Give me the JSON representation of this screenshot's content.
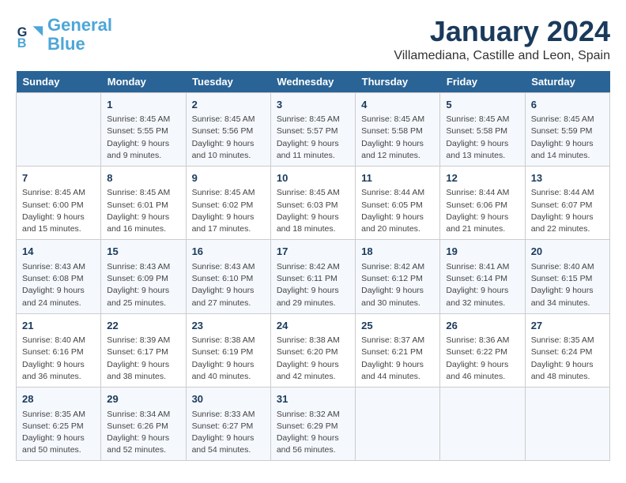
{
  "logo": {
    "text_general": "General",
    "text_blue": "Blue"
  },
  "title": "January 2024",
  "subtitle": "Villamediana, Castille and Leon, Spain",
  "days_of_week": [
    "Sunday",
    "Monday",
    "Tuesday",
    "Wednesday",
    "Thursday",
    "Friday",
    "Saturday"
  ],
  "weeks": [
    [
      {
        "day": "",
        "sunrise": "",
        "sunset": "",
        "daylight": ""
      },
      {
        "day": "1",
        "sunrise": "Sunrise: 8:45 AM",
        "sunset": "Sunset: 5:55 PM",
        "daylight": "Daylight: 9 hours and 9 minutes."
      },
      {
        "day": "2",
        "sunrise": "Sunrise: 8:45 AM",
        "sunset": "Sunset: 5:56 PM",
        "daylight": "Daylight: 9 hours and 10 minutes."
      },
      {
        "day": "3",
        "sunrise": "Sunrise: 8:45 AM",
        "sunset": "Sunset: 5:57 PM",
        "daylight": "Daylight: 9 hours and 11 minutes."
      },
      {
        "day": "4",
        "sunrise": "Sunrise: 8:45 AM",
        "sunset": "Sunset: 5:58 PM",
        "daylight": "Daylight: 9 hours and 12 minutes."
      },
      {
        "day": "5",
        "sunrise": "Sunrise: 8:45 AM",
        "sunset": "Sunset: 5:58 PM",
        "daylight": "Daylight: 9 hours and 13 minutes."
      },
      {
        "day": "6",
        "sunrise": "Sunrise: 8:45 AM",
        "sunset": "Sunset: 5:59 PM",
        "daylight": "Daylight: 9 hours and 14 minutes."
      }
    ],
    [
      {
        "day": "7",
        "sunrise": "Sunrise: 8:45 AM",
        "sunset": "Sunset: 6:00 PM",
        "daylight": "Daylight: 9 hours and 15 minutes."
      },
      {
        "day": "8",
        "sunrise": "Sunrise: 8:45 AM",
        "sunset": "Sunset: 6:01 PM",
        "daylight": "Daylight: 9 hours and 16 minutes."
      },
      {
        "day": "9",
        "sunrise": "Sunrise: 8:45 AM",
        "sunset": "Sunset: 6:02 PM",
        "daylight": "Daylight: 9 hours and 17 minutes."
      },
      {
        "day": "10",
        "sunrise": "Sunrise: 8:45 AM",
        "sunset": "Sunset: 6:03 PM",
        "daylight": "Daylight: 9 hours and 18 minutes."
      },
      {
        "day": "11",
        "sunrise": "Sunrise: 8:44 AM",
        "sunset": "Sunset: 6:05 PM",
        "daylight": "Daylight: 9 hours and 20 minutes."
      },
      {
        "day": "12",
        "sunrise": "Sunrise: 8:44 AM",
        "sunset": "Sunset: 6:06 PM",
        "daylight": "Daylight: 9 hours and 21 minutes."
      },
      {
        "day": "13",
        "sunrise": "Sunrise: 8:44 AM",
        "sunset": "Sunset: 6:07 PM",
        "daylight": "Daylight: 9 hours and 22 minutes."
      }
    ],
    [
      {
        "day": "14",
        "sunrise": "Sunrise: 8:43 AM",
        "sunset": "Sunset: 6:08 PM",
        "daylight": "Daylight: 9 hours and 24 minutes."
      },
      {
        "day": "15",
        "sunrise": "Sunrise: 8:43 AM",
        "sunset": "Sunset: 6:09 PM",
        "daylight": "Daylight: 9 hours and 25 minutes."
      },
      {
        "day": "16",
        "sunrise": "Sunrise: 8:43 AM",
        "sunset": "Sunset: 6:10 PM",
        "daylight": "Daylight: 9 hours and 27 minutes."
      },
      {
        "day": "17",
        "sunrise": "Sunrise: 8:42 AM",
        "sunset": "Sunset: 6:11 PM",
        "daylight": "Daylight: 9 hours and 29 minutes."
      },
      {
        "day": "18",
        "sunrise": "Sunrise: 8:42 AM",
        "sunset": "Sunset: 6:12 PM",
        "daylight": "Daylight: 9 hours and 30 minutes."
      },
      {
        "day": "19",
        "sunrise": "Sunrise: 8:41 AM",
        "sunset": "Sunset: 6:14 PM",
        "daylight": "Daylight: 9 hours and 32 minutes."
      },
      {
        "day": "20",
        "sunrise": "Sunrise: 8:40 AM",
        "sunset": "Sunset: 6:15 PM",
        "daylight": "Daylight: 9 hours and 34 minutes."
      }
    ],
    [
      {
        "day": "21",
        "sunrise": "Sunrise: 8:40 AM",
        "sunset": "Sunset: 6:16 PM",
        "daylight": "Daylight: 9 hours and 36 minutes."
      },
      {
        "day": "22",
        "sunrise": "Sunrise: 8:39 AM",
        "sunset": "Sunset: 6:17 PM",
        "daylight": "Daylight: 9 hours and 38 minutes."
      },
      {
        "day": "23",
        "sunrise": "Sunrise: 8:38 AM",
        "sunset": "Sunset: 6:19 PM",
        "daylight": "Daylight: 9 hours and 40 minutes."
      },
      {
        "day": "24",
        "sunrise": "Sunrise: 8:38 AM",
        "sunset": "Sunset: 6:20 PM",
        "daylight": "Daylight: 9 hours and 42 minutes."
      },
      {
        "day": "25",
        "sunrise": "Sunrise: 8:37 AM",
        "sunset": "Sunset: 6:21 PM",
        "daylight": "Daylight: 9 hours and 44 minutes."
      },
      {
        "day": "26",
        "sunrise": "Sunrise: 8:36 AM",
        "sunset": "Sunset: 6:22 PM",
        "daylight": "Daylight: 9 hours and 46 minutes."
      },
      {
        "day": "27",
        "sunrise": "Sunrise: 8:35 AM",
        "sunset": "Sunset: 6:24 PM",
        "daylight": "Daylight: 9 hours and 48 minutes."
      }
    ],
    [
      {
        "day": "28",
        "sunrise": "Sunrise: 8:35 AM",
        "sunset": "Sunset: 6:25 PM",
        "daylight": "Daylight: 9 hours and 50 minutes."
      },
      {
        "day": "29",
        "sunrise": "Sunrise: 8:34 AM",
        "sunset": "Sunset: 6:26 PM",
        "daylight": "Daylight: 9 hours and 52 minutes."
      },
      {
        "day": "30",
        "sunrise": "Sunrise: 8:33 AM",
        "sunset": "Sunset: 6:27 PM",
        "daylight": "Daylight: 9 hours and 54 minutes."
      },
      {
        "day": "31",
        "sunrise": "Sunrise: 8:32 AM",
        "sunset": "Sunset: 6:29 PM",
        "daylight": "Daylight: 9 hours and 56 minutes."
      },
      {
        "day": "",
        "sunrise": "",
        "sunset": "",
        "daylight": ""
      },
      {
        "day": "",
        "sunrise": "",
        "sunset": "",
        "daylight": ""
      },
      {
        "day": "",
        "sunrise": "",
        "sunset": "",
        "daylight": ""
      }
    ]
  ]
}
